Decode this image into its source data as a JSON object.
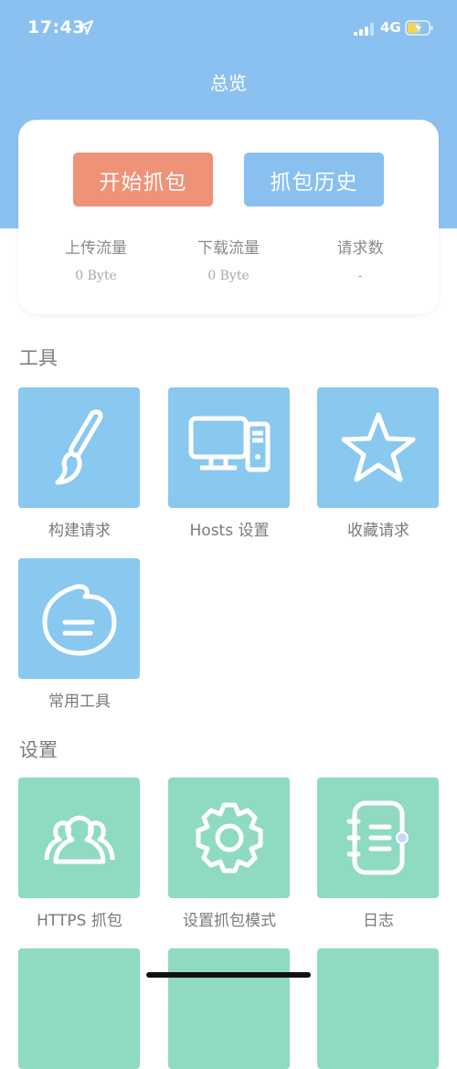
{
  "status_bar": {
    "time": "17:43",
    "network": "4G",
    "icons": [
      "location-arrow-icon",
      "signal-icon",
      "battery-charging-icon"
    ]
  },
  "header": {
    "title": "总览"
  },
  "capture_card": {
    "start_label": "开始抓包",
    "history_label": "抓包历史",
    "stats": [
      {
        "label": "上传流量",
        "value": "0 Byte"
      },
      {
        "label": "下载流量",
        "value": "0 Byte"
      },
      {
        "label": "请求数",
        "value": "-"
      }
    ]
  },
  "tools": {
    "title": "工具",
    "items": [
      {
        "label": "构建请求",
        "icon": "paintbrush-icon"
      },
      {
        "label": "Hosts 设置",
        "icon": "desktop-computer-icon"
      },
      {
        "label": "收藏请求",
        "icon": "star-icon"
      },
      {
        "label": "常用工具",
        "icon": "chat-bubble-icon"
      }
    ]
  },
  "settings": {
    "title": "设置",
    "items": [
      {
        "label": "HTTPS 抓包",
        "icon": "users-icon"
      },
      {
        "label": "设置抓包模式",
        "icon": "gear-icon"
      },
      {
        "label": "日志",
        "icon": "notebook-icon"
      }
    ]
  },
  "colors": {
    "header": "#8bc1f0",
    "start_button": "#ee9278",
    "history_button": "#89c0f0",
    "tool_tile": "#89c8ef",
    "settings_tile": "#8fdac3"
  }
}
